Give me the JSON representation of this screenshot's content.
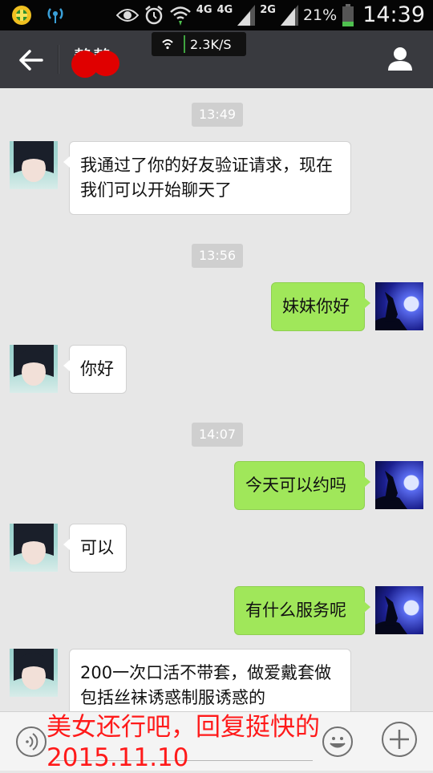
{
  "status_bar": {
    "network_4g_1": "4G",
    "network_4g_2": "4G",
    "network_2g": "2G",
    "battery": "21%",
    "time": "14:39"
  },
  "speed_overlay": "2.3K/S",
  "header": {
    "contact_name": "静静"
  },
  "messages": [
    {
      "type": "time",
      "text": "13:49"
    },
    {
      "type": "received",
      "text": "我通过了你的好友验证请求，现在我们可以开始聊天了"
    },
    {
      "type": "time",
      "text": "13:56"
    },
    {
      "type": "sent",
      "text": "妹妹你好"
    },
    {
      "type": "received",
      "text": "你好"
    },
    {
      "type": "time",
      "text": "14:07"
    },
    {
      "type": "sent",
      "text": "今天可以约吗"
    },
    {
      "type": "received",
      "text": "可以"
    },
    {
      "type": "sent",
      "text": "有什么服务呢"
    },
    {
      "type": "received",
      "text": "200一次口活不带套，做爱戴套做包括丝袜诱惑制服诱惑的"
    }
  ],
  "annotation": {
    "line1": "美女还行吧，回复挺快的",
    "line2": "2015.11.10"
  },
  "icons": [
    "back-arrow-icon",
    "user-profile-icon",
    "voice-icon",
    "emoji-icon",
    "plus-icon",
    "wifi-icon",
    "alarm-icon",
    "eye-icon"
  ]
}
